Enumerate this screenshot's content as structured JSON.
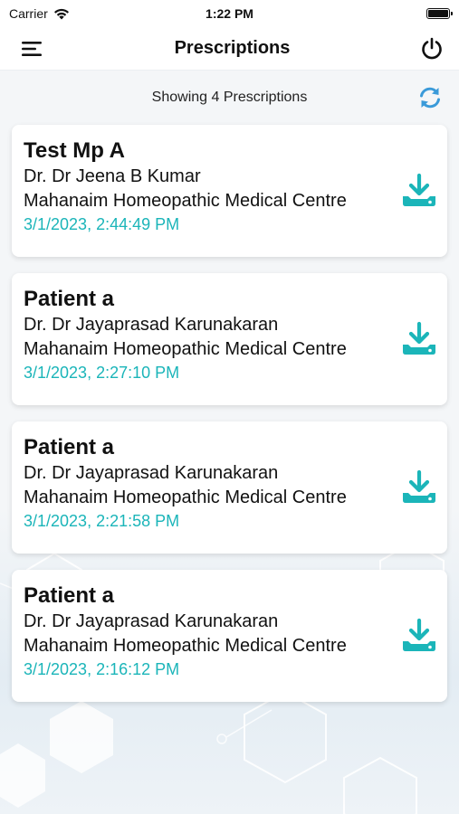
{
  "status_bar": {
    "carrier": "Carrier",
    "time": "1:22 PM"
  },
  "header": {
    "title": "Prescriptions",
    "menu_icon": "hamburger-menu-icon",
    "power_icon": "power-icon"
  },
  "summary": {
    "text": "Showing 4 Prescriptions",
    "refresh_icon": "refresh-icon"
  },
  "colors": {
    "accent": "#1bb5b9",
    "refresh": "#3a9ad9"
  },
  "prescriptions": [
    {
      "patient": "Test Mp A",
      "doctor": "Dr. Dr Jeena B Kumar",
      "clinic": "Mahanaim Homeopathic Medical Centre",
      "datetime": "3/1/2023, 2:44:49 PM"
    },
    {
      "patient": "Patient a",
      "doctor": "Dr. Dr Jayaprasad Karunakaran",
      "clinic": "Mahanaim Homeopathic Medical Centre",
      "datetime": "3/1/2023, 2:27:10 PM"
    },
    {
      "patient": "Patient a",
      "doctor": "Dr. Dr Jayaprasad Karunakaran",
      "clinic": "Mahanaim Homeopathic Medical Centre",
      "datetime": "3/1/2023, 2:21:58 PM"
    },
    {
      "patient": "Patient a",
      "doctor": "Dr. Dr Jayaprasad Karunakaran",
      "clinic": "Mahanaim Homeopathic Medical Centre",
      "datetime": "3/1/2023, 2:16:12 PM"
    }
  ]
}
